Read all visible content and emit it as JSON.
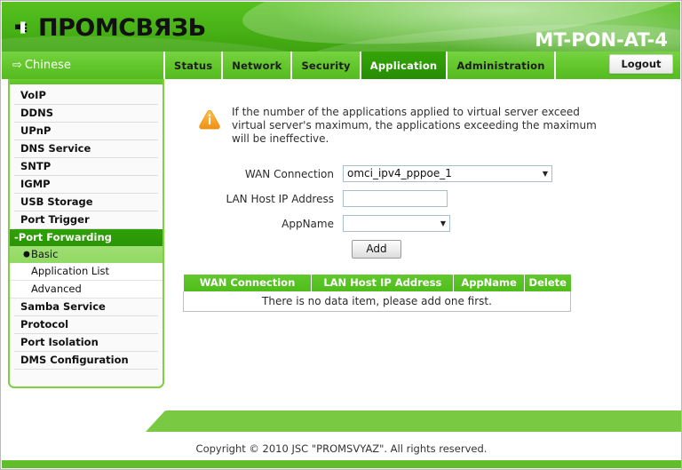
{
  "header": {
    "logo_text": "ПРОМСВЯЗЬ",
    "logo_icon": "plug-connector-icon",
    "model": "MT-PON-AT-4"
  },
  "nav": {
    "language_label": "Chinese",
    "language_arrow": "⇨",
    "tabs": [
      {
        "label": "Status",
        "active": false
      },
      {
        "label": "Network",
        "active": false
      },
      {
        "label": "Security",
        "active": false
      },
      {
        "label": "Application",
        "active": true
      },
      {
        "label": "Administration",
        "active": false
      }
    ],
    "logout_label": "Logout"
  },
  "sidebar": {
    "items": [
      {
        "label": "VoIP"
      },
      {
        "label": "DDNS"
      },
      {
        "label": "UPnP"
      },
      {
        "label": "DNS Service"
      },
      {
        "label": "SNTP"
      },
      {
        "label": "IGMP"
      },
      {
        "label": "USB Storage"
      },
      {
        "label": "Port Trigger"
      }
    ],
    "expanded_item": "-Port Forwarding",
    "sub_items": [
      {
        "label": "Basic",
        "selected": true,
        "bullet": "●"
      },
      {
        "label": "Application List",
        "selected": false
      },
      {
        "label": "Advanced",
        "selected": false
      }
    ],
    "items_after": [
      {
        "label": "Samba Service"
      },
      {
        "label": "Protocol"
      },
      {
        "label": "Port Isolation"
      },
      {
        "label": "DMS Configuration"
      }
    ]
  },
  "main": {
    "notice": {
      "icon": "warning-triangle-icon",
      "text": "If the number of the applications applied to virtual server exceed virtual server's maximum, the applications exceeding the maximum will be ineffective."
    },
    "form": {
      "wan_connection_label": "WAN Connection",
      "wan_connection_value": "omci_ipv4_pppoe_1",
      "lan_host_ip_label": "LAN Host IP Address",
      "lan_host_ip_value": "",
      "lan_host_ip_placeholder": "",
      "appname_label": "AppName",
      "appname_value": "",
      "add_label": "Add",
      "caret": "▼"
    },
    "table": {
      "columns": [
        "WAN Connection",
        "LAN Host IP Address",
        "AppName",
        "Delete"
      ],
      "rows": [],
      "empty_message": "There is no data item, please add one first."
    }
  },
  "footer": {
    "copyright": "Copyright © 2010 JSC \"PROMSVYAZ\". All rights reserved."
  }
}
